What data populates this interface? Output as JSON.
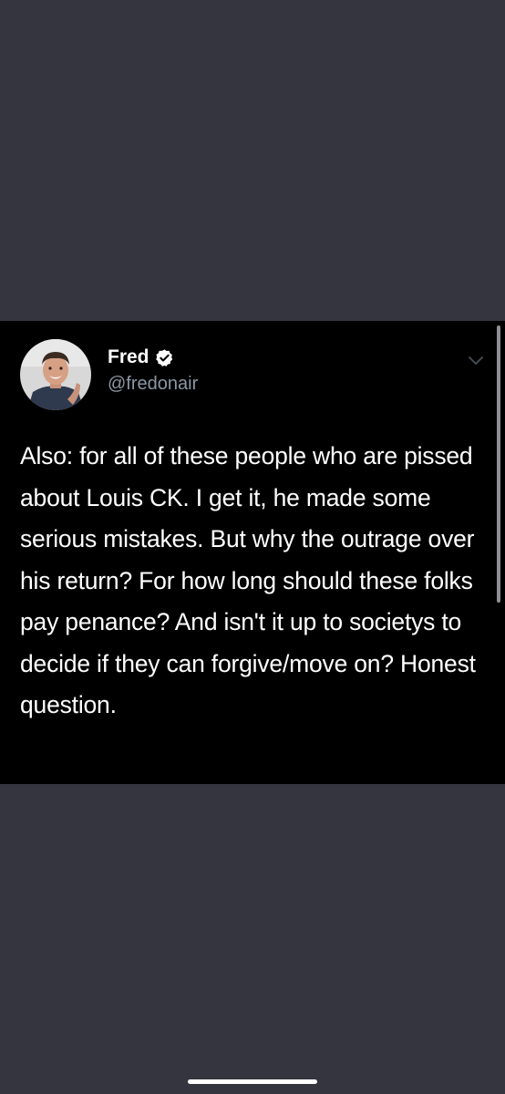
{
  "tweet": {
    "author": {
      "display_name": "Fred",
      "handle": "@fredonair",
      "verified": true,
      "avatar_icon": "profile-photo"
    },
    "text": "Also: for all of these people who are pissed about Louis CK. I get it, he made some serious mistakes. But why the outrage over his return? For how long should these folks pay penance? And isn't it up to societys to decide if they can forgive/move on? Honest question.",
    "menu_icon": "chevron-down-icon"
  },
  "colors": {
    "background": "#34353f",
    "card": "#000000",
    "text": "#ffffff",
    "handle": "#8b98a5",
    "verified_badge": "#ffffff"
  }
}
